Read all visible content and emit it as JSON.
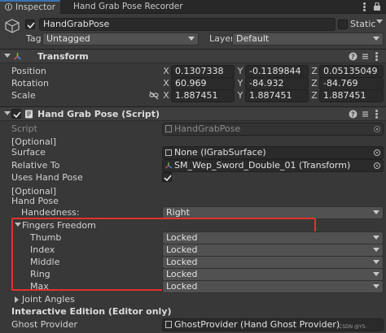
{
  "tabs": [
    {
      "label": "Inspector",
      "icon": "info-icon"
    },
    {
      "label": "Hand Grab Pose Recorder",
      "icon": ""
    }
  ],
  "object": {
    "name": "HandGrabPose",
    "active": true,
    "static_label": "Static",
    "tag_label": "Tag",
    "tag_value": "Untagged",
    "layer_label": "Layer",
    "layer_value": "Default"
  },
  "transform": {
    "title": "Transform",
    "position": {
      "label": "Position",
      "x": "0.1307338",
      "y": "-0.1189844",
      "z": "0.05135049"
    },
    "rotation": {
      "label": "Rotation",
      "x": "60.969",
      "y": "-84.932",
      "z": "-84.769"
    },
    "scale": {
      "label": "Scale",
      "x": "1.887451",
      "y": "1.887451",
      "z": "1.887451"
    },
    "axis_x": "X",
    "axis_y": "Y",
    "axis_z": "Z"
  },
  "script_comp": {
    "title": "Hand Grab Pose (Script)",
    "script_label": "Script",
    "script_value": "HandGrabPose",
    "optional1": "[Optional]",
    "surface_label": "Surface",
    "surface_value": "None (IGrabSurface)",
    "relative_label": "Relative To",
    "relative_value": "SM_Wep_Sword_Double_01 (Transform)",
    "uses_hand_pose_label": "Uses Hand Pose",
    "uses_hand_pose": true,
    "optional2": "[Optional]",
    "hand_pose_label": "Hand Pose",
    "handedness_label": "Handedness:",
    "handedness_value": "Right",
    "fingers_freedom_label": "Fingers Freedom",
    "fingers": [
      {
        "label": "Thumb",
        "value": "Locked"
      },
      {
        "label": "Index",
        "value": "Locked"
      },
      {
        "label": "Middle",
        "value": "Locked"
      },
      {
        "label": "Ring",
        "value": "Locked"
      },
      {
        "label": "Max",
        "value": "Locked"
      }
    ],
    "joint_angles_label": "Joint Angles",
    "interactive_label": "Interactive Edition (Editor only)",
    "ghost_label": "Ghost Provider",
    "ghost_value": "GhostProvider (Hand Ghost Provider)"
  },
  "watermark": "CSDN @YS-",
  "colors": {
    "highlight_box": "#e0312e",
    "tab_accent": "#3a72b0"
  }
}
